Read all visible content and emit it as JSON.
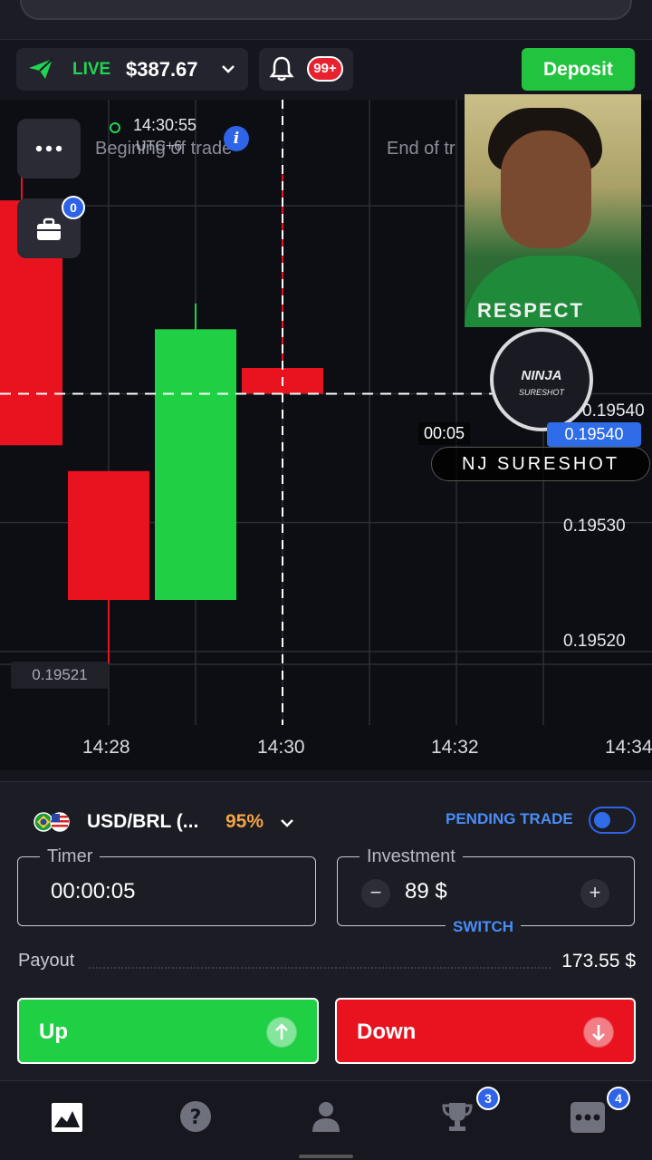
{
  "header": {
    "account_mode": "LIVE",
    "balance": "$387.67",
    "notifications_badge": "99+",
    "deposit_label": "Deposit"
  },
  "chart": {
    "current_time": "14:30:55",
    "timezone": "UTC+6",
    "begin_label": "Begining of trade",
    "end_label": "End of tr",
    "open_trades_count": "0",
    "countdown": "00:05",
    "current_price": "0.19540",
    "price_labels": [
      "0.19540",
      "0.19530",
      "0.19520"
    ],
    "low_label": "0.19521",
    "time_ticks": [
      "14:28",
      "14:30",
      "14:32",
      "14:34"
    ],
    "overlay_name": "NJ SURESHOT",
    "emblem_text": "NINJA",
    "emblem_sub": "SURESHOT",
    "webcam_shirt_text": "RESPECT",
    "colors": {
      "up": "#1fd045",
      "down": "#e8131f",
      "accent": "#2f6ce8"
    }
  },
  "chart_data": {
    "type": "candlestick",
    "x": [
      "14:27",
      "14:28",
      "14:29",
      "14:30"
    ],
    "open": [
      0.19555,
      0.19534,
      0.19524,
      0.19542
    ],
    "close": [
      0.19536,
      0.19524,
      0.19545,
      0.1954
    ],
    "high": [
      0.19557,
      0.19534,
      0.19547,
      0.19557
    ],
    "low": [
      0.19536,
      0.19519,
      0.19524,
      0.1954
    ],
    "ylim": [
      0.19515,
      0.1956
    ],
    "yticks": [
      0.1952,
      0.1953,
      0.1954
    ],
    "xticks": [
      "14:28",
      "14:30",
      "14:32",
      "14:34"
    ]
  },
  "trade": {
    "asset": "USD/BRL (...",
    "payout_pct": "95%",
    "pending_label": "PENDING TRADE",
    "timer_label": "Timer",
    "timer_value": "00:00:05",
    "investment_label": "Investment",
    "investment_value": "89 $",
    "minus": "−",
    "plus": "+",
    "switch_label": "SWITCH",
    "payout_label": "Payout",
    "payout_value": "173.55 $",
    "up_label": "Up",
    "down_label": "Down"
  },
  "nav": {
    "trophy_badge": "3",
    "more_badge": "4"
  }
}
